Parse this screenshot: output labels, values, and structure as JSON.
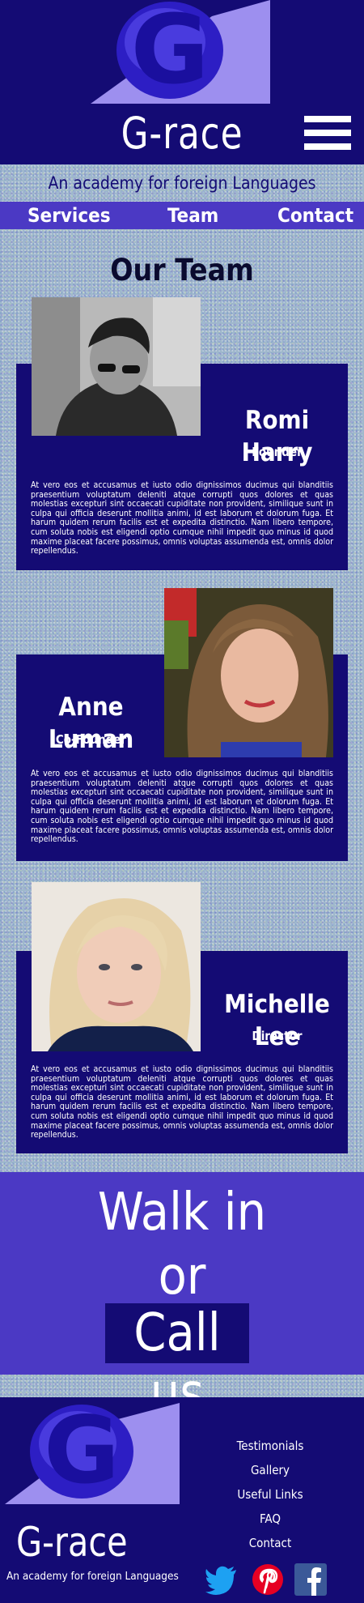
{
  "brand": {
    "name": "G-race",
    "logo_letter": "G",
    "tagline": "An academy for foreign Languages"
  },
  "nav": {
    "services": "Services",
    "team": "Team",
    "contact": "Contact"
  },
  "team": {
    "title": "Our Team",
    "members": [
      {
        "name": "Romi Harry",
        "role": "Founder",
        "bio": "At vero eos et accusamus et iusto odio dignissimos ducimus qui blanditiis praesentium voluptatum deleniti atque corrupti quos dolores et quas molestias excepturi sint occaecati cupiditate non provident, similique sunt in culpa qui officia deserunt mollitia animi, id est laborum et dolorum fuga. Et harum quidem rerum facilis est et expedita distinctio. Nam libero tempore, cum soluta nobis est eligendi optio cumque nihil impedit quo minus id quod maxime placeat facere possimus, omnis voluptas assumenda est, omnis dolor repellendus."
      },
      {
        "name": "Anne Luman",
        "role": "Co-Founder",
        "bio": "At vero eos et accusamus et iusto odio dignissimos ducimus qui blanditiis praesentium voluptatum deleniti atque corrupti quos dolores et quas molestias excepturi sint occaecati cupiditate non provident, similique sunt in culpa qui officia deserunt mollitia animi, id est laborum et dolorum fuga. Et harum quidem rerum facilis est et expedita distinctio. Nam libero tempore, cum soluta nobis est eligendi optio cumque nihil impedit quo minus id quod maxime placeat facere possimus, omnis voluptas assumenda est, omnis dolor repellendus."
      },
      {
        "name": "Michelle Lee",
        "role": "Director",
        "bio": "At vero eos et accusamus et iusto odio dignissimos ducimus qui blanditiis praesentium voluptatum deleniti atque corrupti quos dolores et quas molestias excepturi sint occaecati cupiditate non provident, similique sunt in culpa qui officia deserunt mollitia animi, id est laborum et dolorum fuga. Et harum quidem rerum facilis est et expedita distinctio. Nam libero tempore, cum soluta nobis est eligendi optio cumque nihil impedit quo minus id quod maxime placeat facere possimus, omnis voluptas assumenda est, omnis dolor repellendus."
      }
    ]
  },
  "cta": {
    "line1": "Walk in",
    "line2": "or",
    "line3": "Call us"
  },
  "footer": {
    "links": [
      "Testimonials",
      "Gallery",
      "Useful Links",
      "FAQ",
      "Contact"
    ],
    "social_icons": [
      "twitter-icon",
      "pinterest-icon",
      "facebook-icon"
    ]
  },
  "colors": {
    "navy": "#140b74",
    "violet": "#4b39c4",
    "twitter": "#1da1f2",
    "pinterest": "#e60023",
    "facebook": "#3b5998"
  }
}
